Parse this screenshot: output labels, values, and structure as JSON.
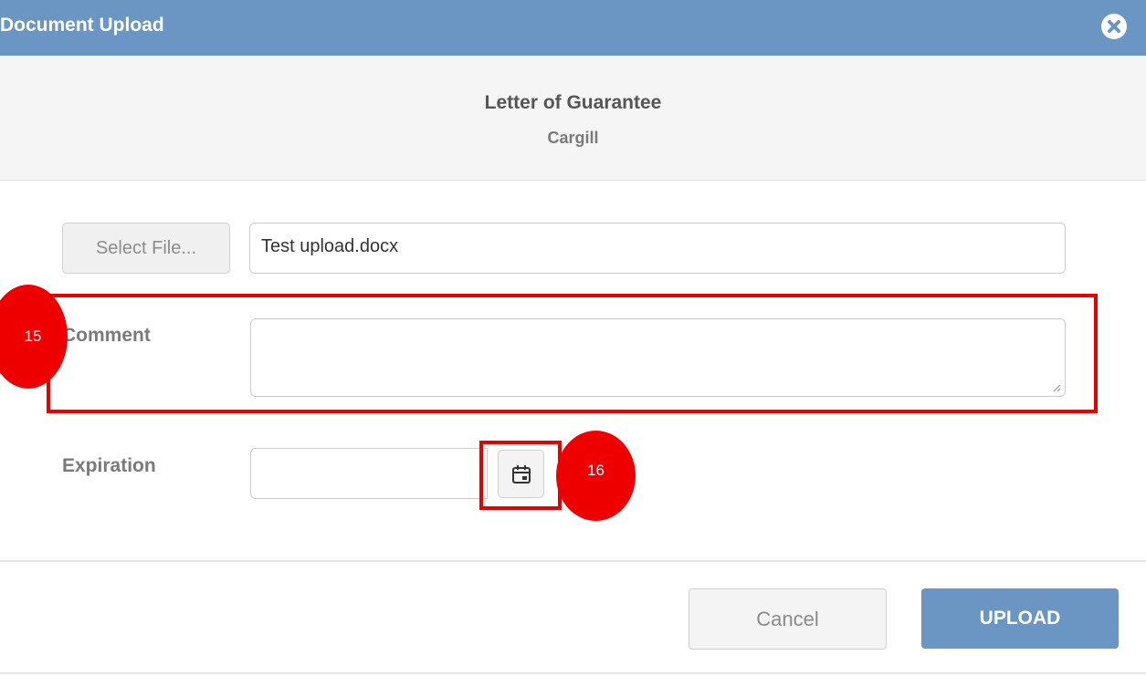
{
  "dialog": {
    "title": "Document Upload"
  },
  "document": {
    "name": "Letter of Guarantee",
    "party": "Cargill"
  },
  "file": {
    "select_label": "Select File...",
    "filename": "Test upload.docx"
  },
  "comment": {
    "label": "Comment",
    "value": ""
  },
  "expiration": {
    "label": "Expiration",
    "value": ""
  },
  "annotations": [
    {
      "number": "15",
      "color": "#ee0000"
    },
    {
      "number": "16",
      "color": "#ee0000"
    }
  ],
  "footer": {
    "cancel_label": "Cancel",
    "upload_label": "UPLOAD"
  },
  "colors": {
    "header": "#6b95c2",
    "accent": "#6b95c2",
    "annotation": "#e60000"
  },
  "icons": {
    "close": "close-circle-icon",
    "calendar": "calendar-icon"
  }
}
